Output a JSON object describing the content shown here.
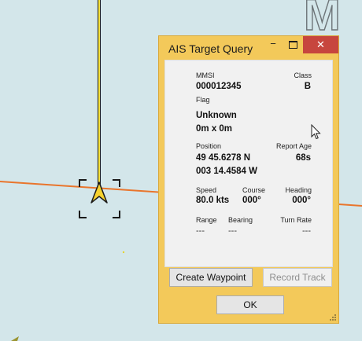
{
  "map": {
    "corner_glyph": "M",
    "vessel_icon": "arrow-icon"
  },
  "dialog": {
    "title": "AIS Target Query",
    "minimize": "−",
    "close": "✕",
    "fields": {
      "mmsi_label": "MMSI",
      "mmsi": "000012345",
      "class_label": "Class",
      "class": "B",
      "flag_label": "Flag",
      "name": "Unknown",
      "size": "0m x 0m",
      "position_label": "Position",
      "lat": "49 45.6278 N",
      "lon": "003 14.4584 W",
      "report_age_label": "Report Age",
      "report_age": "68s",
      "speed_label": "Speed",
      "speed": "80.0 kts",
      "course_label": "Course",
      "course": "000°",
      "heading_label": "Heading",
      "heading": "000°",
      "range_label": "Range",
      "range": "---",
      "bearing_label": "Bearing",
      "bearing": "---",
      "turn_rate_label": "Turn Rate",
      "turn_rate": "---"
    },
    "buttons": {
      "create_waypoint": "Create Waypoint",
      "record_track": "Record Track",
      "ok": "OK"
    }
  }
}
